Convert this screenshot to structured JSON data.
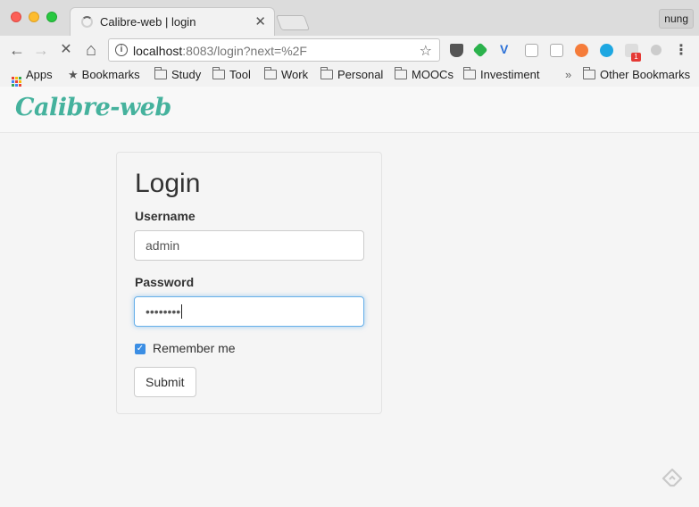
{
  "browser": {
    "tab_title": "Calibre-web | login",
    "profile_name": "nung",
    "url_host": "localhost",
    "url_rest": ":8083/login?next=%2F",
    "extension_badge": "1"
  },
  "bookmarks": {
    "apps": "Apps",
    "bookmarks": "Bookmarks",
    "folders": [
      "Study",
      "Tool",
      "Work",
      "Personal",
      "MOOCs",
      "Investiment"
    ],
    "overflow": "»",
    "other": "Other Bookmarks"
  },
  "app": {
    "brand": "Calibre-web",
    "brand_color": "#45b29d"
  },
  "login": {
    "title": "Login",
    "username_label": "Username",
    "username_value": "admin",
    "password_label": "Password",
    "password_mask": "••••••••",
    "remember_label": "Remember me",
    "remember_checked": true,
    "submit_label": "Submit"
  },
  "icons": {
    "back": "←",
    "forward": "→",
    "stop": "✕",
    "home": "⌂",
    "star": "☆",
    "menu": "⋮",
    "close": "✕",
    "check": "✓"
  }
}
